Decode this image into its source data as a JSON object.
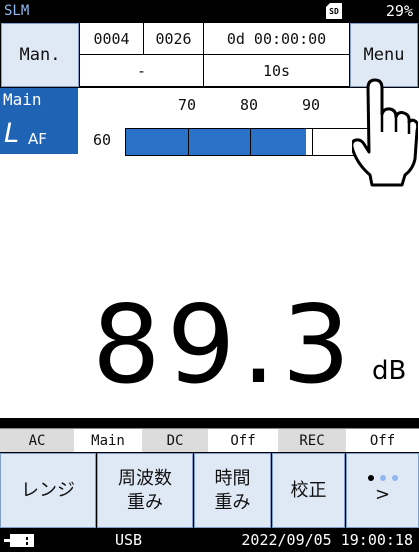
{
  "statusbar": {
    "mode": "SLM",
    "sd_label": "SD",
    "battery": "29%"
  },
  "header": {
    "mode_button": "Man.",
    "counter_a": "0004",
    "counter_b": "0026",
    "elapsed": "0d 00:00:00",
    "sub_left": "-",
    "interval": "10s",
    "menu_button": "Menu"
  },
  "bargraph": {
    "tag": "Main",
    "weighting_symbol": "L",
    "weighting_sub": "AF",
    "scale_start": "60",
    "scale_labels": [
      "70",
      "80",
      "90"
    ],
    "scale_min": 60,
    "scale_max": 100,
    "level": 89.3,
    "fill_color": "#2a72c8"
  },
  "reading": {
    "value": "89.3",
    "unit": "dB"
  },
  "status_row": {
    "ac_label": "AC",
    "ac_value": "Main",
    "dc_label": "DC",
    "dc_value": "Off",
    "rec_label": "REC",
    "rec_value": "Off"
  },
  "softkeys": {
    "range": "レンジ",
    "freq_weight_l1": "周波数",
    "freq_weight_l2": "重み",
    "time_weight_l1": "時間",
    "time_weight_l2": "重み",
    "calibrate": "校正",
    "next": ">"
  },
  "bottombar": {
    "connection": "USB",
    "datetime": "2022/09/05  19:00:18"
  },
  "colors": {
    "accent": "#1f63b5",
    "key_bg": "#dfe8f5",
    "status_text": "#8fb8ee"
  },
  "icons": {
    "sd": "sd-card-icon",
    "battery": "battery-icon",
    "usb": "usb-plug-icon",
    "cursor": "hand-pointer-icon"
  }
}
